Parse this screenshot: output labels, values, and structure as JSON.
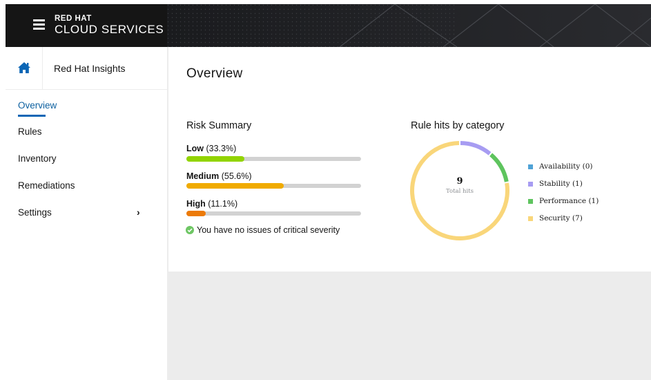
{
  "header": {
    "brand_top": "RED HAT",
    "brand_bottom": "CLOUD SERVICES"
  },
  "sidebar": {
    "app_name": "Red Hat Insights",
    "items": [
      {
        "label": "Overview",
        "active": true
      },
      {
        "label": "Rules"
      },
      {
        "label": "Inventory"
      },
      {
        "label": "Remediations"
      },
      {
        "label": "Settings",
        "has_submenu": true
      }
    ]
  },
  "main": {
    "title": "Overview",
    "risk_summary": {
      "title": "Risk Summary",
      "levels": [
        {
          "name": "Low",
          "pct_label": "(33.3%)",
          "fraction": 0.333,
          "color": "#92d400"
        },
        {
          "name": "Medium",
          "pct_label": "(55.6%)",
          "fraction": 0.556,
          "color": "#f0ab00"
        },
        {
          "name": "High",
          "pct_label": "(11.1%)",
          "fraction": 0.111,
          "color": "#ec7a08"
        }
      ],
      "critical_message": "You have no issues of critical severity"
    },
    "rule_hits": {
      "title": "Rule hits by category",
      "total": "9",
      "total_label": "Total hits",
      "legend": [
        {
          "label": "Availability (0)",
          "value": 0,
          "color": "#4fa2d6"
        },
        {
          "label": "Stability (1)",
          "value": 1,
          "color": "#a79cf2"
        },
        {
          "label": "Performance (1)",
          "value": 1,
          "color": "#5ec45e"
        },
        {
          "label": "Security (7)",
          "value": 7,
          "color": "#f9d67a"
        }
      ]
    }
  },
  "colors": {
    "accent": "#0b66b5",
    "success": "#3e8635"
  }
}
